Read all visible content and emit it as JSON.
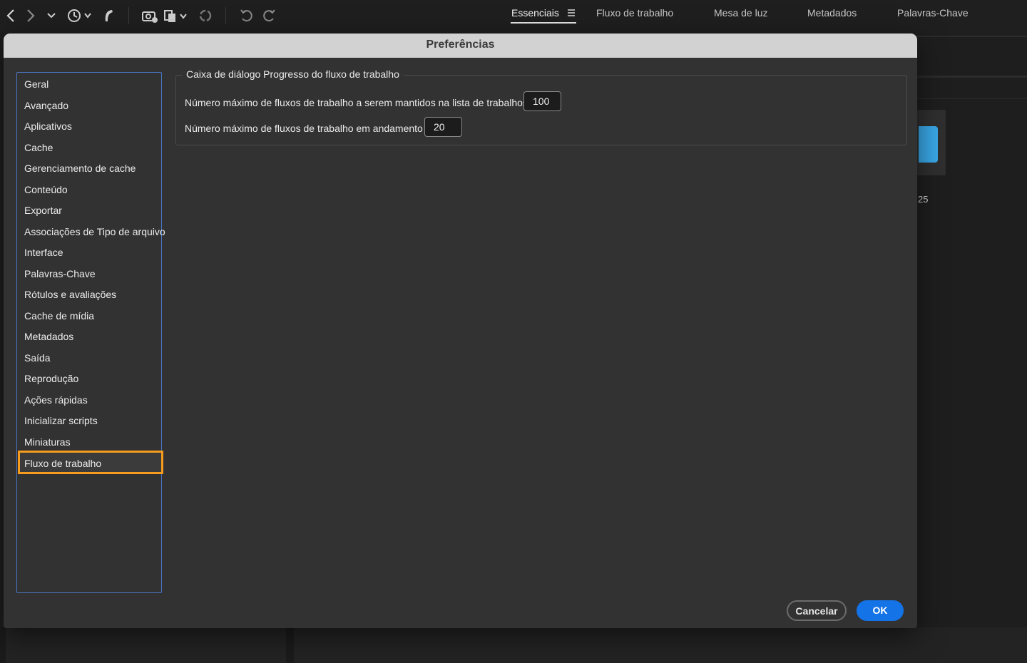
{
  "toolbar": {
    "icons": [
      "back-icon",
      "forward-icon",
      "chevron-down-icon",
      "history-icon",
      "boomerang-icon",
      "camera-import-icon",
      "copy-stack-icon",
      "refresh-icon",
      "undo-icon",
      "redo-icon"
    ]
  },
  "workspaces": {
    "tabs": [
      "Essenciais",
      "Fluxo de trabalho",
      "Mesa de luz",
      "Metadados",
      "Palavras-Chave"
    ],
    "active": "Essenciais"
  },
  "background": {
    "thumb_label": "25",
    "folder_color": "#3aa8e8"
  },
  "dialog": {
    "title": "Preferências",
    "categories": [
      "Geral",
      "Avançado",
      "Aplicativos",
      "Cache",
      "Gerenciamento de cache",
      "Conteúdo",
      "Exportar",
      "Associações de Tipo de arquivo",
      "Interface",
      "Palavras-Chave",
      "Rótulos e avaliações",
      "Cache de mídia",
      "Metadados",
      "Saída",
      "Reprodução",
      "Ações rápidas",
      "Inicializar scripts",
      "Miniaturas",
      "Fluxo de trabalho"
    ],
    "selected_category": "Fluxo de trabalho",
    "group": {
      "title": "Caixa de diálogo Progresso do fluxo de trabalho",
      "max_jobs_label": "Número máximo de fluxos de trabalho a serem mantidos na lista de trabalhos",
      "max_jobs_value": "100",
      "max_running_label": "Número máximo de fluxos de trabalho em andamento",
      "max_running_value": "20"
    },
    "buttons": {
      "cancel": "Cancelar",
      "ok": "OK"
    }
  },
  "colors": {
    "accent_blue": "#1473e6",
    "selection_highlight": "#f59b1d",
    "list_border": "#4a76c4"
  }
}
